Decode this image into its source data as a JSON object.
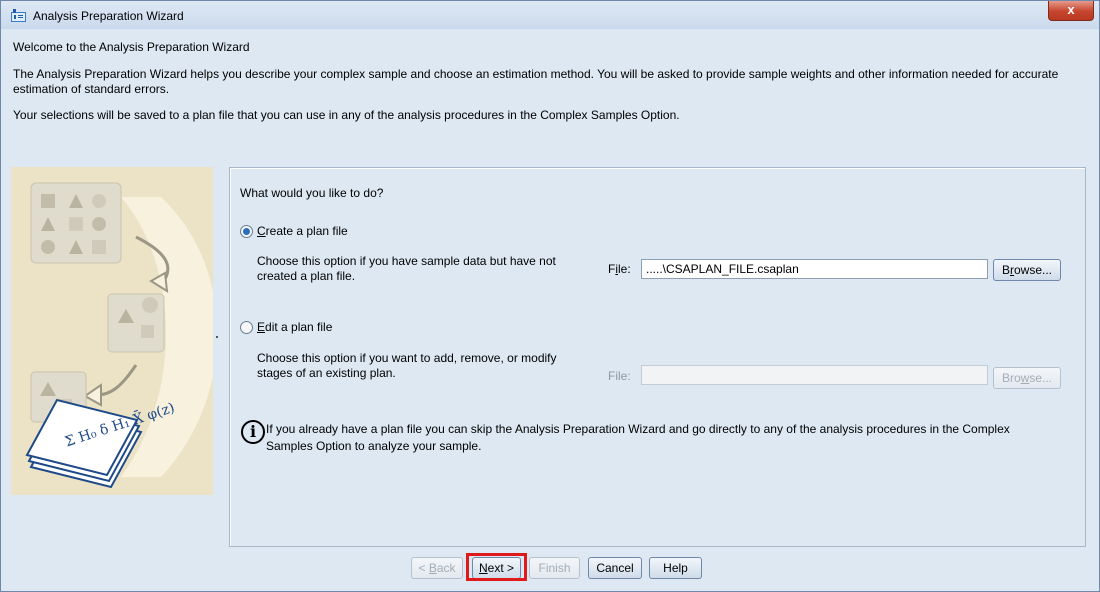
{
  "window": {
    "title": "Analysis Preparation Wizard",
    "close_glyph": "x"
  },
  "intro": {
    "heading": "Welcome to the Analysis Preparation Wizard",
    "description": "The Analysis Preparation Wizard helps you describe your complex sample and choose an estimation method. You will be asked to provide sample weights and other information needed for accurate estimation of standard errors.",
    "note": "Your selections will be saved to a plan file that you can use in any of the analysis procedures in the Complex Samples Option."
  },
  "panel": {
    "question": "What would you like to do?",
    "create": {
      "mnemonic": "C",
      "label_rest": "reate a plan file",
      "selected": true,
      "description_line1": "Choose this option if you have sample data but have not",
      "description_line2": "created a plan file.",
      "file_label_pre": "F",
      "file_label_mnemonic": "i",
      "file_label_post": "le:",
      "file_value": ".....\\CSAPLAN_FILE.csaplan",
      "browse_pre": "B",
      "browse_mnemonic": "r",
      "browse_post": "owse..."
    },
    "edit": {
      "mnemonic": "E",
      "label_rest": "dit a plan file",
      "selected": false,
      "description_line1": "Choose this option if you want to add, remove, or modify",
      "description_line2": "stages of an existing plan.",
      "file_label": "File:",
      "file_value": "",
      "browse_pre": "Bro",
      "browse_mnemonic": "w",
      "browse_post": "se..."
    },
    "info_icon_glyph": "i",
    "info_text_line1": "If you already have a plan file you can skip the Analysis Preparation Wizard and go directly to any of the analysis procedures in the Complex",
    "info_text_line2": "Samples Option to analyze your sample."
  },
  "buttons": {
    "back_pre": "< ",
    "back_mnemonic": "B",
    "back_post": "ack",
    "next_mnemonic": "N",
    "next_post": "ext >",
    "finish": "Finish",
    "cancel": "Cancel",
    "help": "Help"
  },
  "colors": {
    "highlight": "#e01a1a",
    "illustration_bg": "#ece3c7",
    "dialog_bg": "#dde8f3"
  },
  "illustration": {
    "formula_text": "Σ H₀ δ H₁ X̄ φ(z)"
  }
}
